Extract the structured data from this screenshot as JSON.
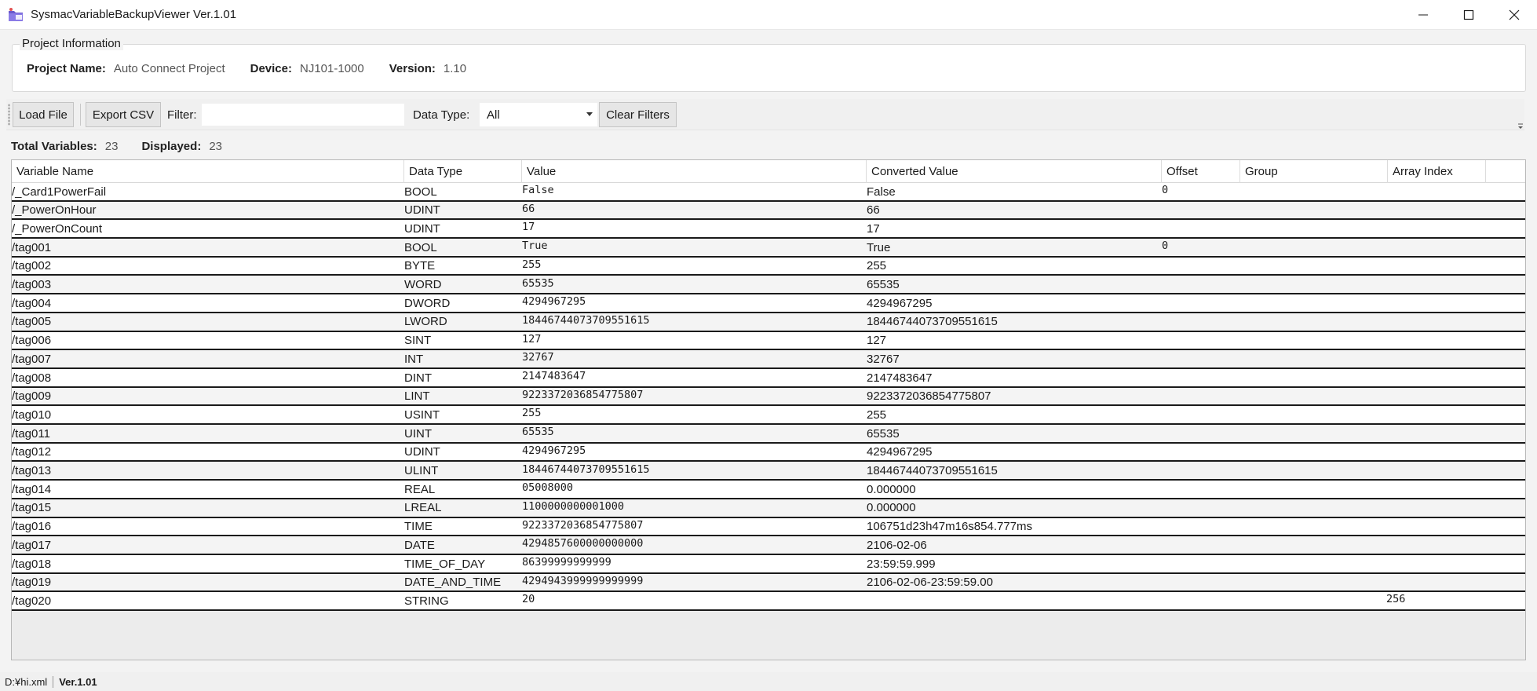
{
  "window": {
    "title": "SysmacVariableBackupViewer Ver.1.01",
    "icon": "app-folder-icon"
  },
  "project_info": {
    "legend": "Project Information",
    "project_name_label": "Project Name:",
    "project_name": "Auto Connect Project",
    "device_label": "Device:",
    "device": "NJ101-1000",
    "version_label": "Version:",
    "version": "1.10"
  },
  "toolbar": {
    "load_file": "Load File",
    "export_csv": "Export CSV",
    "filter_label": "Filter:",
    "filter_value": "",
    "data_type_label": "Data Type:",
    "data_type_selected": "All",
    "clear_filters": "Clear Filters"
  },
  "stats": {
    "total_label": "Total Variables:",
    "total": "23",
    "displayed_label": "Displayed:",
    "displayed": "23"
  },
  "grid": {
    "columns": [
      "Variable Name",
      "Data Type",
      "Value",
      "Converted Value",
      "Offset",
      "Group",
      "Array Index"
    ],
    "rows": [
      {
        "name": "/_Card1PowerFail",
        "type": "BOOL",
        "value": "False",
        "converted": "False",
        "offset": "0",
        "group": "",
        "array": ""
      },
      {
        "name": "/_PowerOnHour",
        "type": "UDINT",
        "value": "66",
        "converted": "66",
        "offset": "",
        "group": "",
        "array": ""
      },
      {
        "name": "/_PowerOnCount",
        "type": "UDINT",
        "value": "17",
        "converted": "17",
        "offset": "",
        "group": "",
        "array": ""
      },
      {
        "name": "/tag001",
        "type": "BOOL",
        "value": "True",
        "converted": "True",
        "offset": "0",
        "group": "",
        "array": ""
      },
      {
        "name": "/tag002",
        "type": "BYTE",
        "value": "255",
        "converted": "255",
        "offset": "",
        "group": "",
        "array": ""
      },
      {
        "name": "/tag003",
        "type": "WORD",
        "value": "65535",
        "converted": "65535",
        "offset": "",
        "group": "",
        "array": ""
      },
      {
        "name": "/tag004",
        "type": "DWORD",
        "value": "4294967295",
        "converted": "4294967295",
        "offset": "",
        "group": "",
        "array": ""
      },
      {
        "name": "/tag005",
        "type": "LWORD",
        "value": "18446744073709551615",
        "converted": "18446744073709551615",
        "offset": "",
        "group": "",
        "array": ""
      },
      {
        "name": "/tag006",
        "type": "SINT",
        "value": "127",
        "converted": "127",
        "offset": "",
        "group": "",
        "array": ""
      },
      {
        "name": "/tag007",
        "type": "INT",
        "value": "32767",
        "converted": "32767",
        "offset": "",
        "group": "",
        "array": ""
      },
      {
        "name": "/tag008",
        "type": "DINT",
        "value": "2147483647",
        "converted": "2147483647",
        "offset": "",
        "group": "",
        "array": ""
      },
      {
        "name": "/tag009",
        "type": "LINT",
        "value": "9223372036854775807",
        "converted": "9223372036854775807",
        "offset": "",
        "group": "",
        "array": ""
      },
      {
        "name": "/tag010",
        "type": "USINT",
        "value": "255",
        "converted": "255",
        "offset": "",
        "group": "",
        "array": ""
      },
      {
        "name": "/tag011",
        "type": "UINT",
        "value": "65535",
        "converted": "65535",
        "offset": "",
        "group": "",
        "array": ""
      },
      {
        "name": "/tag012",
        "type": "UDINT",
        "value": "4294967295",
        "converted": "4294967295",
        "offset": "",
        "group": "",
        "array": ""
      },
      {
        "name": "/tag013",
        "type": "ULINT",
        "value": "18446744073709551615",
        "converted": "18446744073709551615",
        "offset": "",
        "group": "",
        "array": ""
      },
      {
        "name": "/tag014",
        "type": "REAL",
        "value": "05008000",
        "converted": "0.000000",
        "offset": "",
        "group": "",
        "array": ""
      },
      {
        "name": "/tag015",
        "type": "LREAL",
        "value": "1100000000001000",
        "converted": "0.000000",
        "offset": "",
        "group": "",
        "array": ""
      },
      {
        "name": "/tag016",
        "type": "TIME",
        "value": "9223372036854775807",
        "converted": "106751d23h47m16s854.777ms",
        "offset": "",
        "group": "",
        "array": ""
      },
      {
        "name": "/tag017",
        "type": "DATE",
        "value": "4294857600000000000",
        "converted": "2106-02-06",
        "offset": "",
        "group": "",
        "array": ""
      },
      {
        "name": "/tag018",
        "type": "TIME_OF_DAY",
        "value": "86399999999999",
        "converted": "23:59:59.999",
        "offset": "",
        "group": "",
        "array": ""
      },
      {
        "name": "/tag019",
        "type": "DATE_AND_TIME",
        "value": "4294943999999999999",
        "converted": "2106-02-06-23:59:59.00",
        "offset": "",
        "group": "",
        "array": ""
      },
      {
        "name": "/tag020",
        "type": "STRING",
        "value": "20",
        "converted": "",
        "offset": "",
        "group": "",
        "array": "256"
      }
    ]
  },
  "statusbar": {
    "path": "D:¥hi.xml",
    "version": "Ver.1.01"
  }
}
